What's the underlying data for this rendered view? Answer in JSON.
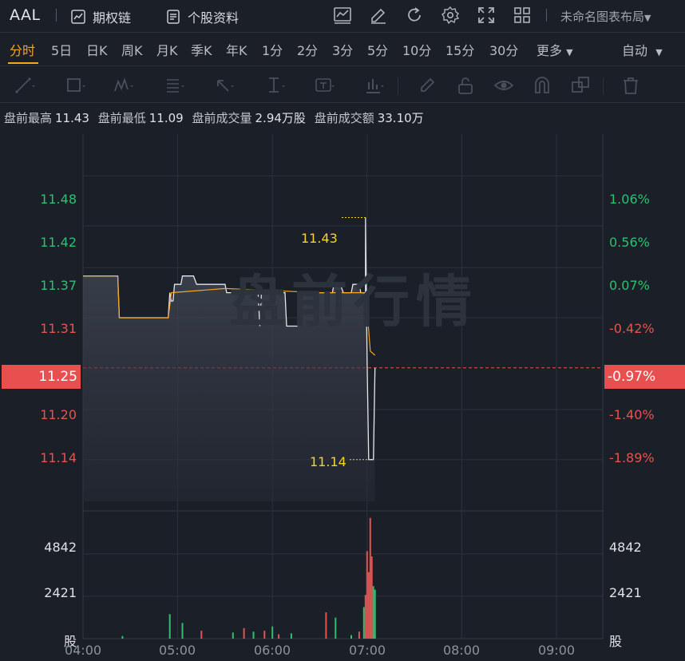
{
  "header": {
    "ticker": "AAL",
    "options_chain": "期权链",
    "stock_profile": "个股资料",
    "layout_name": "未命名图表布局"
  },
  "periods": [
    "分时",
    "5日",
    "日K",
    "周K",
    "月K",
    "季K",
    "年K",
    "1分",
    "2分",
    "3分",
    "5分",
    "10分",
    "15分",
    "30分",
    "更多"
  ],
  "active_period": "分时",
  "mode": "自动",
  "stats": {
    "high_label": "盘前最高",
    "high": "11.43",
    "low_label": "盘前最低",
    "low": "11.09",
    "vol_label": "盘前成交量",
    "vol": "2.94万股",
    "amt_label": "盘前成交额",
    "amt": "33.10万"
  },
  "watermark": "盘前行情",
  "axis": {
    "price_labels": [
      "11.48",
      "11.42",
      "11.37",
      "11.31",
      "11.20",
      "11.14"
    ],
    "pct_labels": [
      "1.06%",
      "0.56%",
      "0.07%",
      "-0.42%",
      "-1.40%",
      "-1.89%"
    ],
    "current_price": "11.25",
    "current_pct": "-0.97%",
    "volume_labels": [
      "4842",
      "2421"
    ],
    "volume_unit": "股",
    "time_labels": [
      "04:00",
      "05:00",
      "06:00",
      "07:00",
      "08:00",
      "09:00"
    ]
  },
  "markers": {
    "high": "11.43",
    "low": "11.14"
  },
  "colors": {
    "up": "#2fbf71",
    "down": "#e2554f",
    "accent": "#f5a623",
    "current": "#e8504f"
  },
  "chart_data": {
    "type": "line",
    "title": "",
    "x_range": [
      "04:00",
      "09:30"
    ],
    "ylim": [
      11.09,
      11.53
    ],
    "prev_close": 11.36,
    "series": [
      {
        "name": "",
        "points": [
          [
            "04:00",
            11.36
          ],
          [
            "04:22",
            11.36
          ],
          [
            "04:23",
            11.31
          ],
          [
            "04:54",
            11.31
          ],
          [
            "04:55",
            11.34
          ],
          [
            "04:56",
            11.33
          ],
          [
            "04:57",
            11.33
          ],
          [
            "04:58",
            11.35
          ],
          [
            "05:02",
            11.35
          ],
          [
            "05:03",
            11.36
          ],
          [
            "05:10",
            11.36
          ],
          [
            "05:12",
            11.35
          ],
          [
            "05:30",
            11.35
          ],
          [
            "05:31",
            11.34
          ],
          [
            "05:51",
            11.34
          ],
          [
            "05:52",
            11.3
          ],
          [
            "05:53",
            11.34
          ],
          [
            "06:08",
            11.34
          ],
          [
            "06:09",
            11.3
          ],
          [
            "06:16",
            11.3
          ],
          [
            "06:17",
            11.34
          ],
          [
            "06:38",
            11.34
          ],
          [
            "06:39",
            11.35
          ],
          [
            "06:43",
            11.35
          ],
          [
            "06:45",
            11.34
          ],
          [
            "06:50",
            11.34
          ],
          [
            "06:51",
            11.35
          ],
          [
            "06:55",
            11.35
          ],
          [
            "06:56",
            11.34
          ],
          [
            "06:59",
            11.34
          ],
          [
            "06:59",
            11.43
          ],
          [
            "07:00",
            11.26
          ],
          [
            "07:01",
            11.14
          ],
          [
            "07:04",
            11.14
          ],
          [
            "07:05",
            11.25
          ]
        ]
      },
      {
        "name": "",
        "points": [
          [
            "04:00",
            11.36
          ],
          [
            "04:22",
            11.36
          ],
          [
            "04:23",
            11.31
          ],
          [
            "04:54",
            11.31
          ],
          [
            "04:56",
            11.34
          ],
          [
            "05:30",
            11.345
          ],
          [
            "06:30",
            11.34
          ],
          [
            "06:58",
            11.34
          ],
          [
            "07:00",
            11.32
          ],
          [
            "07:02",
            11.27
          ],
          [
            "07:05",
            11.265
          ]
        ]
      }
    ],
    "volume": {
      "ylim": [
        0,
        7300
      ],
      "ticks": [
        2421,
        4842
      ],
      "bars": [
        [
          "04:25",
          150,
          "up"
        ],
        [
          "04:55",
          1400,
          "up"
        ],
        [
          "05:03",
          900,
          "up"
        ],
        [
          "05:15",
          450,
          "down"
        ],
        [
          "05:35",
          350,
          "up"
        ],
        [
          "05:42",
          600,
          "down"
        ],
        [
          "05:48",
          400,
          "up"
        ],
        [
          "05:55",
          450,
          "down"
        ],
        [
          "06:00",
          700,
          "up"
        ],
        [
          "06:04",
          250,
          "down"
        ],
        [
          "06:12",
          300,
          "up"
        ],
        [
          "06:34",
          1500,
          "down"
        ],
        [
          "06:40",
          1200,
          "up"
        ],
        [
          "06:50",
          200,
          "up"
        ],
        [
          "06:55",
          400,
          "down"
        ],
        [
          "06:58",
          1800,
          "up"
        ],
        [
          "06:59",
          2500,
          "down"
        ],
        [
          "07:00",
          5000,
          "down"
        ],
        [
          "07:01",
          3800,
          "down"
        ],
        [
          "07:02",
          6900,
          "down"
        ],
        [
          "07:03",
          4700,
          "down"
        ],
        [
          "07:04",
          3000,
          "up"
        ],
        [
          "07:05",
          2800,
          "up"
        ]
      ]
    }
  }
}
